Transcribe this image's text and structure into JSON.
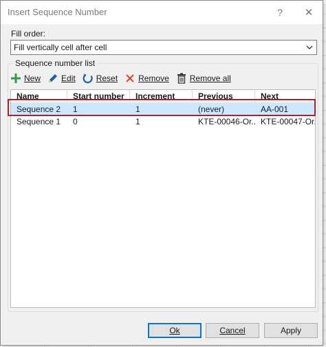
{
  "window": {
    "title": "Insert Sequence Number",
    "help_glyph": "?",
    "close_glyph": "✕"
  },
  "fill_order": {
    "label": "Fill order:",
    "selected": "Fill vertically cell after cell"
  },
  "sequence_list": {
    "label": "Sequence number list",
    "toolbar": {
      "new": "New",
      "edit": "Edit",
      "reset": "Reset",
      "remove": "Remove",
      "remove_all": "Remove all"
    },
    "columns": [
      "Name",
      "Start number",
      "Increment",
      "Previous",
      "Next"
    ],
    "rows": [
      {
        "name": "Sequence 2",
        "start": "1",
        "increment": "1",
        "previous": "(never)",
        "next": "AA-001"
      },
      {
        "name": "Sequence 1",
        "start": "0",
        "increment": "1",
        "previous": "KTE-00046-Or...",
        "next": "KTE-00047-Or..."
      }
    ],
    "selected_row": 0
  },
  "buttons": {
    "ok": "Ok",
    "cancel": "Cancel",
    "apply": "Apply"
  },
  "colors": {
    "selection": "#cce8ff",
    "highlight_border": "#b01e2e",
    "new_icon": "#2e9b4a",
    "edit_icon": "#1a5fb4",
    "reset_icon": "#1a5fb4",
    "remove_icon": "#d9452b"
  }
}
